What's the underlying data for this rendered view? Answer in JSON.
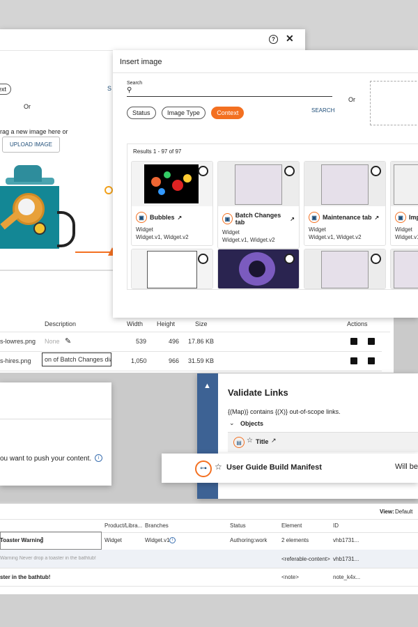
{
  "dialog_back": {
    "text_chip": "ext",
    "s_cut": "S",
    "or_label": "Or",
    "drag_text": "rag a new image here or",
    "upload_label": "UPLOAD IMAGE",
    "table": {
      "headers": {
        "description": "Description",
        "width": "Width",
        "height": "Height",
        "size": "Size",
        "actions": "Actions"
      },
      "rows": [
        {
          "file": "s-lowres.png",
          "description": "None",
          "width": "539",
          "height": "496",
          "size": "17.86 KB"
        },
        {
          "file": "s-hires.png",
          "description": "on of Batch Changes dialog",
          "width": "1,050",
          "height": "966",
          "size": "31.59 KB"
        }
      ]
    }
  },
  "insert_image": {
    "title": "Insert image",
    "search_label": "Search",
    "or_label": "Or",
    "filters": [
      "Status",
      "Image Type",
      "Context"
    ],
    "search_button": "SEARCH",
    "results_label": "Results 1 - 97 of 97",
    "tiles": [
      {
        "name": "Bubbles",
        "type": "Widget",
        "versions": "Widget.v1, Widget.v2"
      },
      {
        "name": "Batch Changes tab",
        "type": "Widget",
        "versions": "Widget.v1, Widget.v2"
      },
      {
        "name": "Maintenance tab",
        "type": "Widget",
        "versions": "Widget.v1, Widget.v2"
      },
      {
        "name": "Imp",
        "type": "Widget",
        "versions": "Widget.v1, W"
      }
    ]
  },
  "push_card": {
    "text": "ou want to push your content."
  },
  "validate": {
    "title": "Validate Links",
    "map_text": "{(Map)} contains {(X)} out-of-scope links.",
    "objects_label": "Objects",
    "title_item": "Title"
  },
  "manifest_bar": {
    "title": "User Guide Build Manifest",
    "will_be": "Will be"
  },
  "bottom_table": {
    "view_label": "View:",
    "view_value": "Default",
    "headers": [
      "Product/Libra...",
      "Branches",
      "Status",
      "Element",
      "ID"
    ],
    "rows": [
      {
        "name": "Toaster Warning",
        "product": "Widget",
        "branch": "Widget.v1",
        "status": "Authoring:work",
        "element": "2 elements",
        "id": "vhb1731..."
      },
      {
        "name": "Warning Never drop a toaster in the bathtub!",
        "product": "",
        "branch": "",
        "status": "",
        "element": "<referable-content>",
        "id": "vhb1731..."
      },
      {
        "name": "ster in the bathtub!",
        "product": "",
        "branch": "",
        "status": "",
        "element": "<note>",
        "id": "note_k4x..."
      }
    ]
  }
}
